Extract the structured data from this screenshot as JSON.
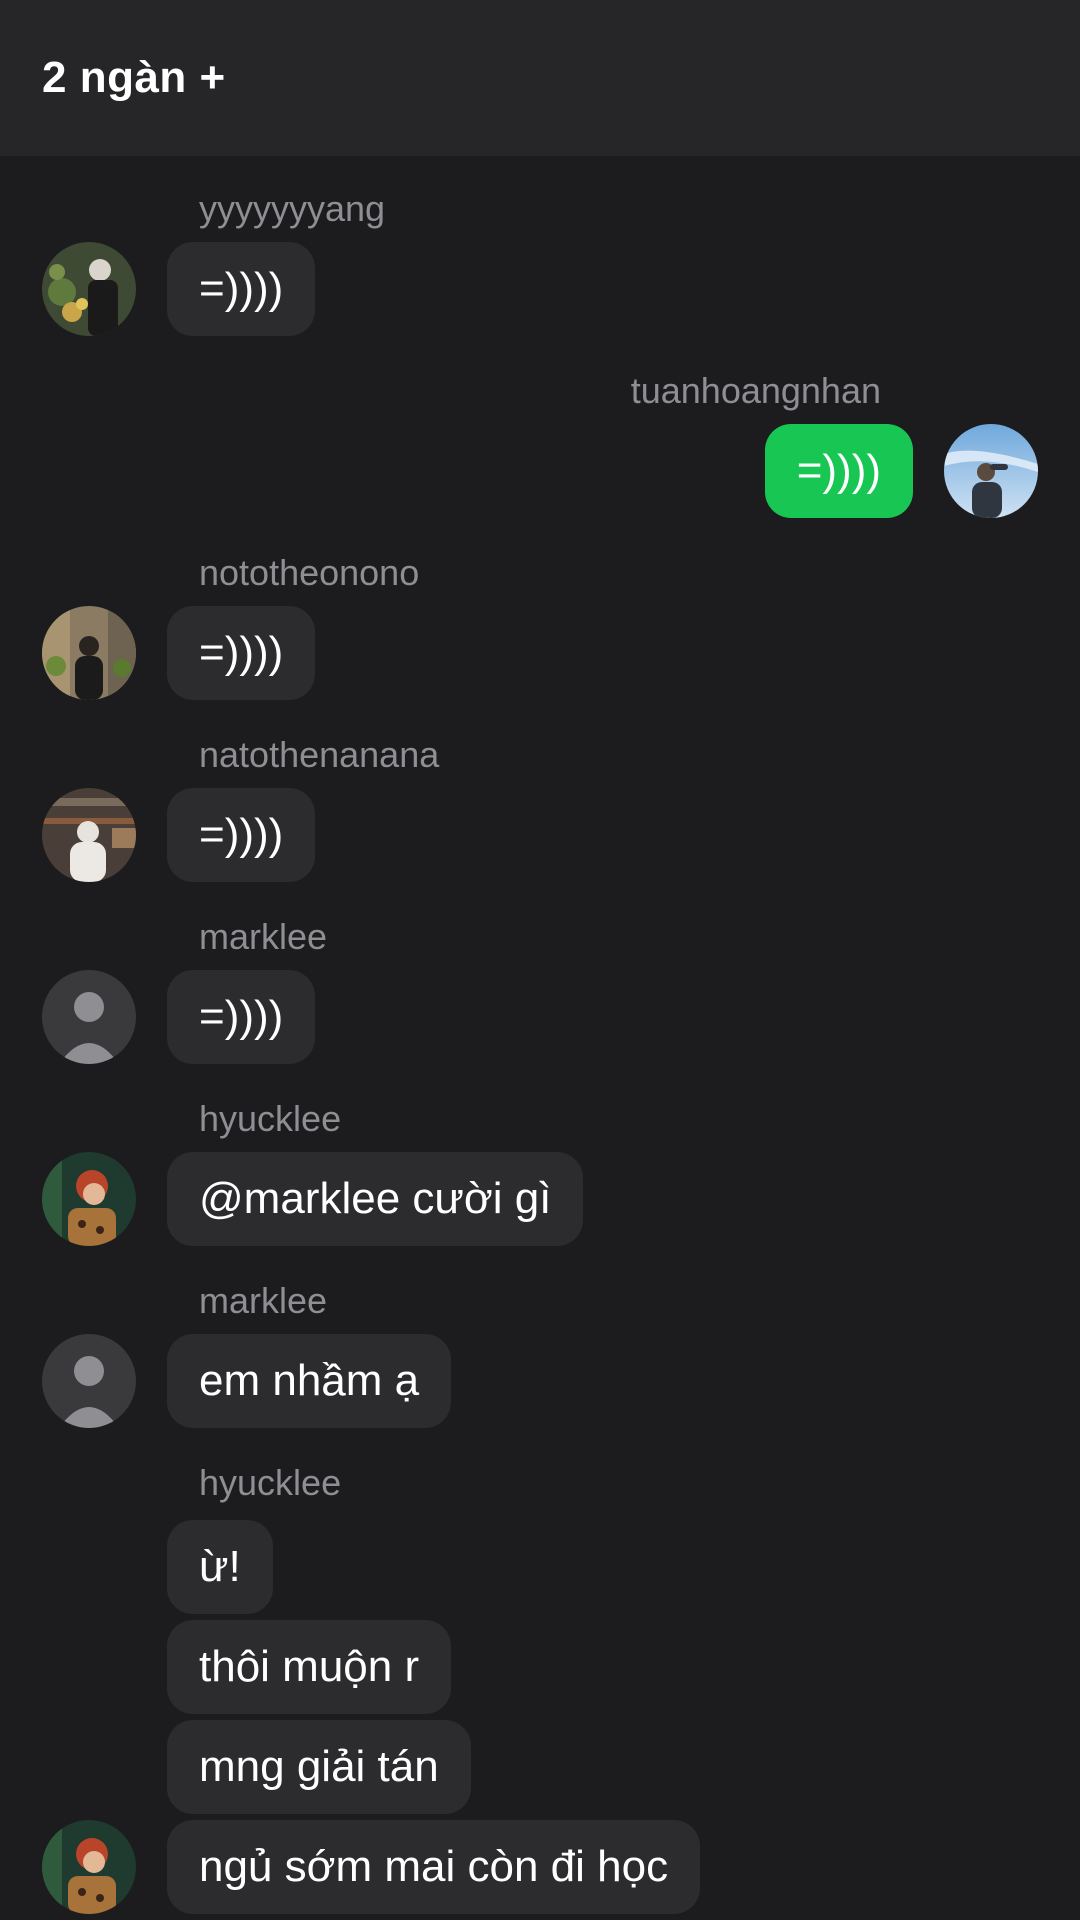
{
  "header": {
    "title": "2 ngàn +"
  },
  "messages": [
    {
      "username": "yyyyyyyang",
      "text": "=))))",
      "avatar": "photo-avatar-flowers"
    },
    {
      "username": "tuanhoangnhan",
      "text": "=))))",
      "avatar": "photo-avatar-sky",
      "own": true
    },
    {
      "username": "nototheonono",
      "text": "=))))",
      "avatar": "photo-avatar-street"
    },
    {
      "username": "natothenanana",
      "text": "=))))",
      "avatar": "photo-avatar-cafe"
    },
    {
      "username": "marklee",
      "text": "=))))",
      "avatar": "default-avatar-icon"
    },
    {
      "username": "hyucklee",
      "text": "@marklee cười gì",
      "avatar": "photo-avatar-redhair"
    },
    {
      "username": "marklee",
      "text": "em nhầm ạ",
      "avatar": "default-avatar-icon"
    },
    {
      "username": "hyucklee",
      "texts": [
        "ừ!",
        "thôi muộn r",
        "mng giải tán",
        "ngủ sớm mai còn đi học"
      ],
      "avatar": "photo-avatar-redhair"
    }
  ],
  "colors": {
    "background": "#1c1c1e",
    "header": "#262628",
    "bubble": "#2c2c2e",
    "own_bubble": "#17c653",
    "username": "#8e8e93"
  }
}
